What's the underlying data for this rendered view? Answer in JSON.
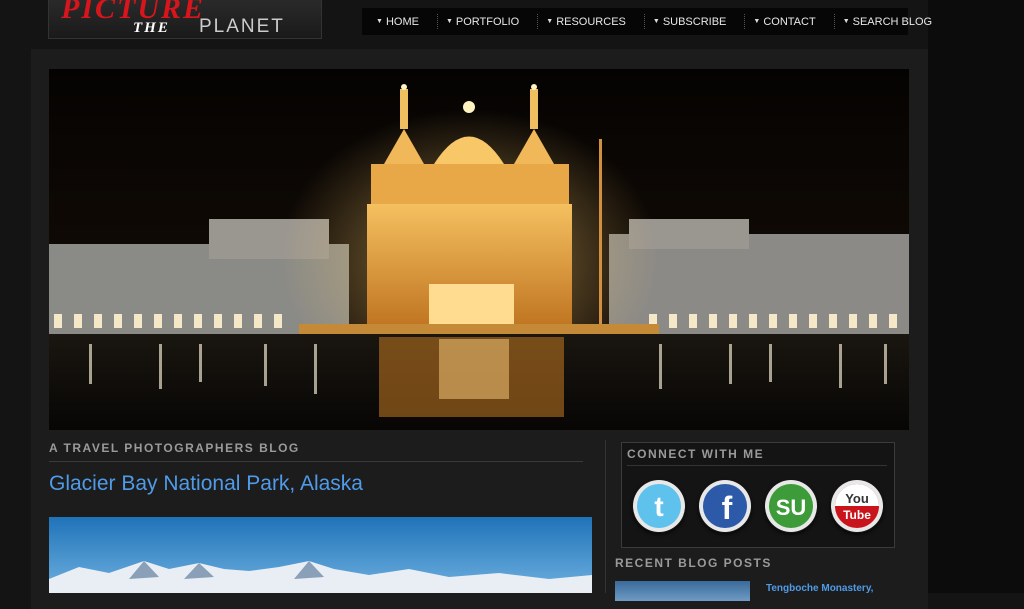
{
  "logo": {
    "line1": "PICTURE",
    "line2a": "THE",
    "line2b": "PLANET"
  },
  "nav": {
    "items": [
      {
        "label": "HOME"
      },
      {
        "label": "PORTFOLIO"
      },
      {
        "label": "RESOURCES"
      },
      {
        "label": "SUBSCRIBE"
      },
      {
        "label": "CONTACT"
      },
      {
        "label": "SEARCH BLOG"
      }
    ]
  },
  "main": {
    "section_label": "A TRAVEL PHOTOGRAPHERS BLOG",
    "post_title": "Glacier Bay National Park, Alaska"
  },
  "sidebar": {
    "connect_title": "CONNECT WITH ME",
    "social": [
      {
        "name": "twitter-icon",
        "glyph": "t",
        "color": "#5ec2ec"
      },
      {
        "name": "facebook-icon",
        "glyph": "f",
        "color": "#2d5aa8"
      },
      {
        "name": "stumbleupon-icon",
        "glyph": "su",
        "color": "#3d9b3a"
      },
      {
        "name": "youtube-icon",
        "glyph_top": "You",
        "glyph_bottom": "Tube",
        "color": "#c8141a"
      }
    ],
    "recent_title": "RECENT BLOG POSTS",
    "recent_link": "Tengboche Monastery,"
  },
  "colors": {
    "accent": "#4f9be8",
    "background": "#141414",
    "logo_red": "#d8141c"
  }
}
